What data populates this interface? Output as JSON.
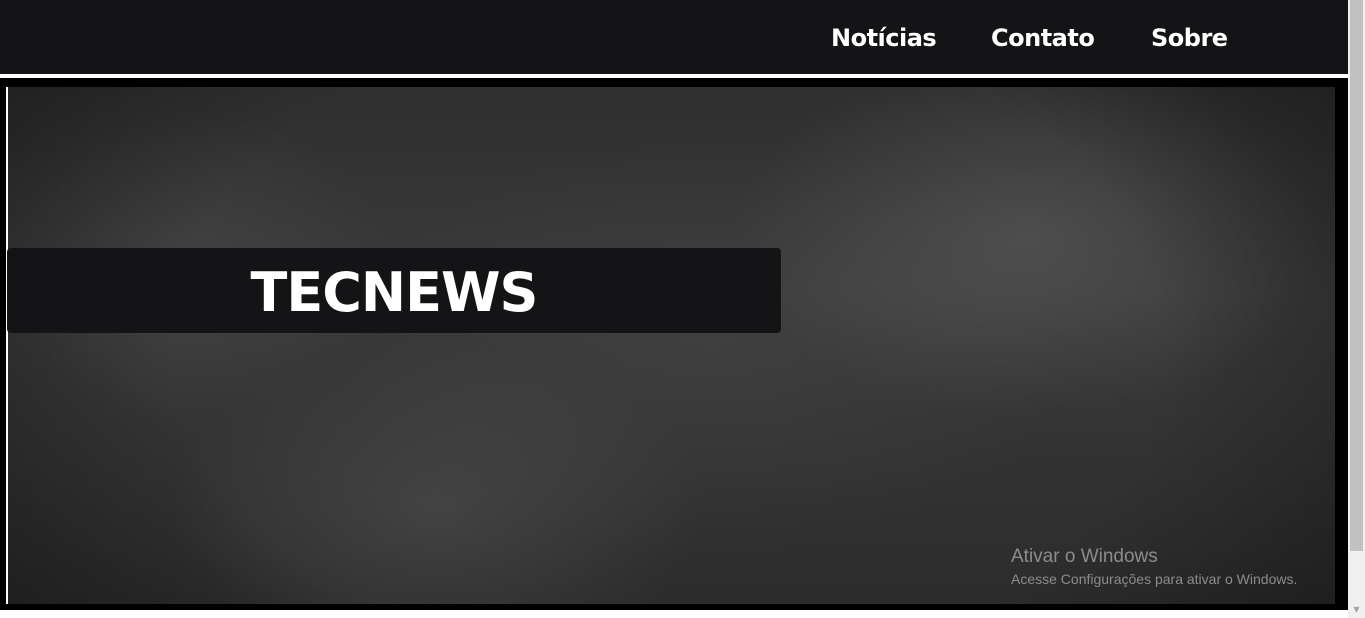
{
  "nav": {
    "items": [
      {
        "label": "Notícias"
      },
      {
        "label": "Contato"
      },
      {
        "label": "Sobre"
      }
    ]
  },
  "hero": {
    "title": "TECNEWS"
  },
  "watermark": {
    "title": "Ativar o Windows",
    "subtitle": "Acesse Configurações para ativar o Windows."
  },
  "scrollbar": {
    "up_icon": "arrow-up-icon",
    "down_icon": "arrow-down-icon"
  },
  "colors": {
    "topbar": "#141416",
    "title_box": "#141416",
    "text": "#ffffff",
    "watermark": "#8c8c8c"
  }
}
